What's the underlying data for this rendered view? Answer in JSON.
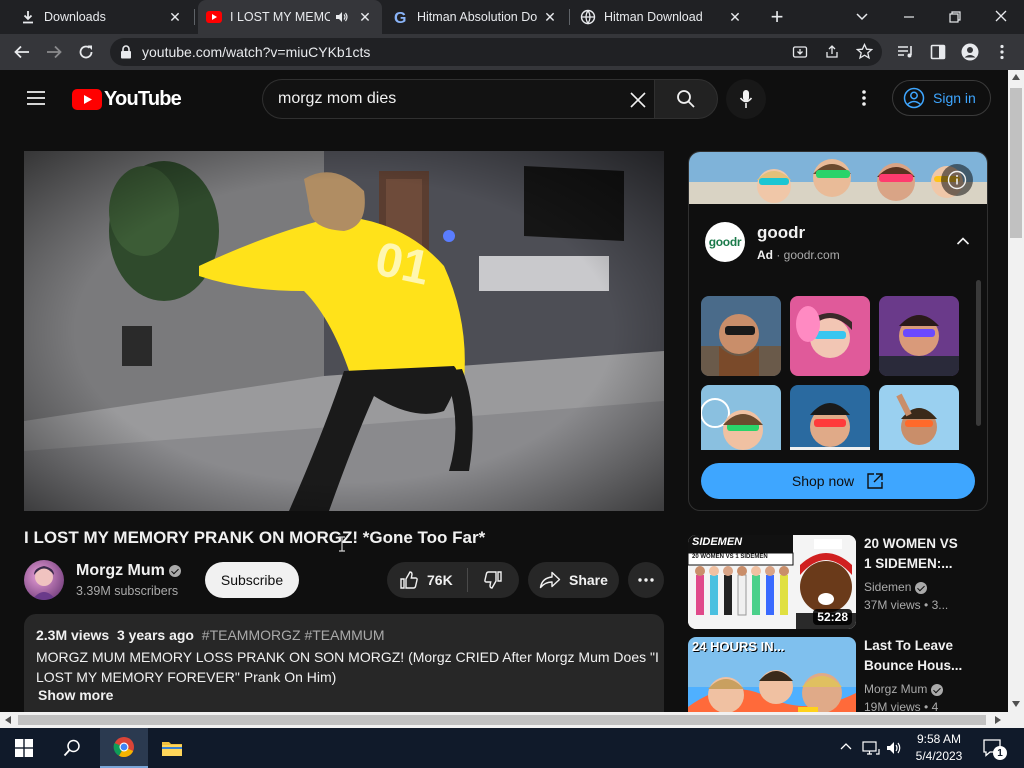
{
  "browser": {
    "tabs": [
      {
        "title": "Downloads",
        "icon": "download-icon",
        "active": false
      },
      {
        "title": "I LOST MY MEMOR",
        "icon": "youtube-icon",
        "active": true
      },
      {
        "title": "Hitman Absolution Do",
        "icon": "google-icon",
        "active": false
      },
      {
        "title": "Hitman Download",
        "icon": "globe-icon",
        "active": false
      }
    ],
    "new_tab": "+",
    "url": "youtube.com/watch?v=miuCYKb1cts"
  },
  "header": {
    "logo_text": "YouTube",
    "search_value": "morgz mom dies",
    "sign_in_label": "Sign in"
  },
  "video": {
    "title": "I LOST MY MEMORY PRANK ON MORGZ! *Gone Too Far*",
    "channel": "Morgz Mum",
    "subscribers": "3.39M subscribers",
    "subscribe_label": "Subscribe",
    "likes": "76K",
    "share_label": "Share"
  },
  "description": {
    "views": "2.3M views",
    "age": "3 years ago",
    "hashtags": "#TEAMMORGZ #TEAMMUM",
    "text_line1": "MORGZ MUM MEMORY LOSS PRANK ON SON MORGZ! (Morgz CRIED After Morgz Mum Does \"I",
    "text_line2": "LOST MY MEMORY FOREVER\" Prank On Him)",
    "show_more": "Show more"
  },
  "ad": {
    "brand_logo": "goodr",
    "brand": "goodr",
    "ad_label": "Ad",
    "domain": "goodr.com",
    "shop_label": "Shop now"
  },
  "sidebar": {
    "items": [
      {
        "title_line1": "20 WOMEN VS",
        "title_line2": "1 SIDEMEN:...",
        "channel": "Sidemen",
        "views": "37M views",
        "age": "3...",
        "duration": "52:28",
        "thumb_text1": "SIDEMEN",
        "thumb_text2": "20 WOMEN VS 1 SIDEMEN"
      },
      {
        "title_line1": "Last To Leave",
        "title_line2": "Bounce Hous...",
        "channel": "Morgz Mum",
        "views": "19M views",
        "age": "4",
        "thumb_text1": "24 HOURS IN..."
      }
    ]
  },
  "taskbar": {
    "time": "9:58 AM",
    "date": "5/4/2023",
    "notification_count": "1"
  },
  "colors": {
    "youtube_red": "#ff0000",
    "link_blue": "#3ea6ff",
    "shop_blue": "#3ea6ff",
    "background": "#0f0f0f"
  }
}
